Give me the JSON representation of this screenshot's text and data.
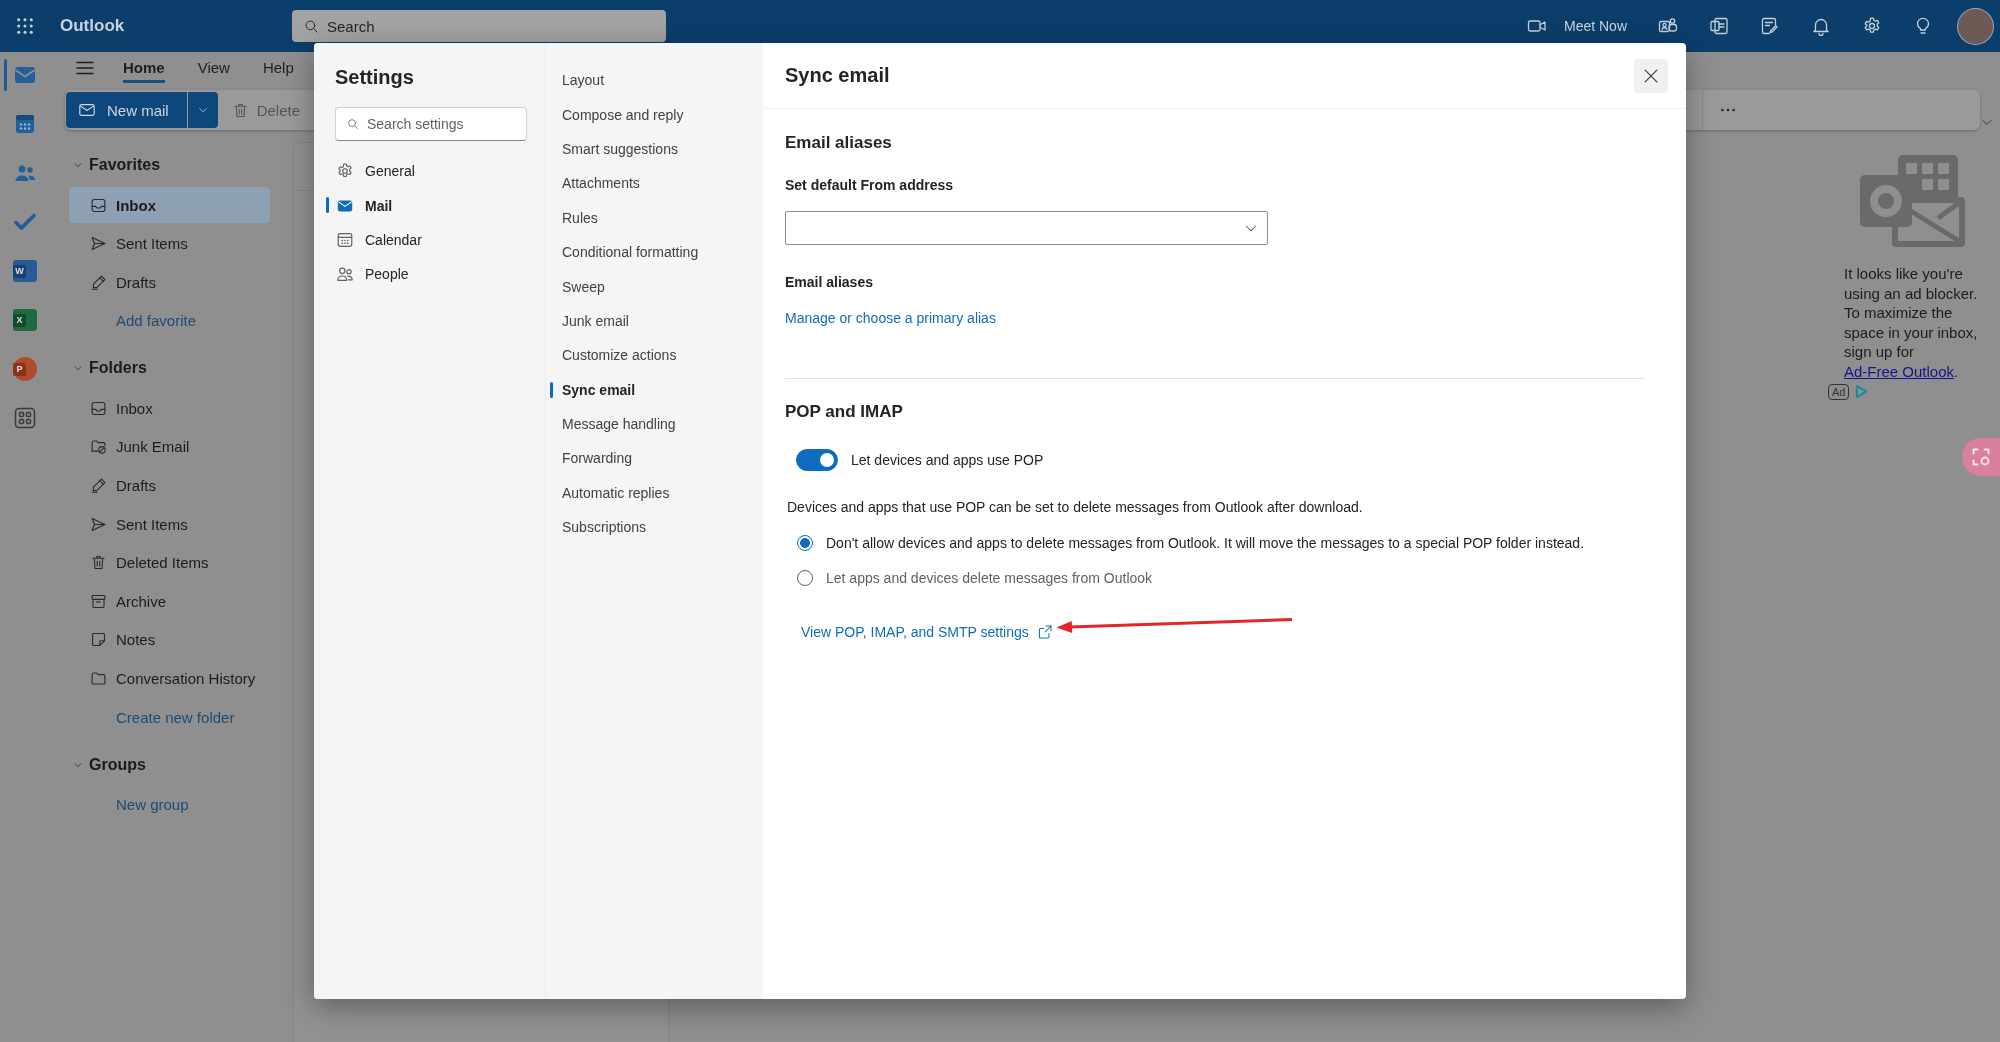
{
  "top_bar": {
    "app_name": "Outlook",
    "search": {
      "placeholder": "Search"
    },
    "meet_now": "Meet Now"
  },
  "rail": [
    {
      "kind": "mail",
      "selected": true
    },
    {
      "kind": "calendar",
      "selected": false
    },
    {
      "kind": "people",
      "selected": false
    },
    {
      "kind": "todo",
      "selected": false
    },
    {
      "kind": "word",
      "letter": "W",
      "selected": false
    },
    {
      "kind": "excel",
      "letter": "X",
      "selected": false
    },
    {
      "kind": "powerpoint",
      "letter": "P",
      "selected": false
    },
    {
      "kind": "apps",
      "selected": false
    }
  ],
  "ribbon": {
    "tabs": [
      {
        "label": "Home",
        "selected": true
      },
      {
        "label": "View",
        "selected": false
      },
      {
        "label": "Help",
        "selected": false
      }
    ],
    "new_mail": "New mail",
    "delete": {
      "label": "Delete",
      "disabled": true
    }
  },
  "folder_pane": {
    "sections": [
      {
        "title": "Favorites",
        "expanded": true,
        "items": [
          {
            "label": "Inbox",
            "kind": "inbox",
            "selected": true
          },
          {
            "label": "Sent Items",
            "kind": "sent",
            "selected": false
          },
          {
            "label": "Drafts",
            "kind": "drafts",
            "selected": false
          }
        ],
        "action": "Add favorite"
      },
      {
        "title": "Folders",
        "expanded": true,
        "items": [
          {
            "label": "Inbox",
            "kind": "inbox",
            "selected": false
          },
          {
            "label": "Junk Email",
            "kind": "junk",
            "selected": false
          },
          {
            "label": "Drafts",
            "kind": "drafts",
            "selected": false
          },
          {
            "label": "Sent Items",
            "kind": "sent",
            "selected": false
          },
          {
            "label": "Deleted Items",
            "kind": "deleted",
            "selected": false
          },
          {
            "label": "Archive",
            "kind": "archive",
            "selected": false
          },
          {
            "label": "Notes",
            "kind": "notes",
            "selected": false
          },
          {
            "label": "Conversation History",
            "kind": "folder",
            "selected": false
          }
        ],
        "action": "Create new folder"
      },
      {
        "title": "Groups",
        "expanded": true,
        "action": "New group"
      }
    ]
  },
  "ad": {
    "message": "It looks like you're using an ad blocker. To maximize the space in your inbox, sign up for ",
    "link": "Ad-Free Outlook",
    "message_end": ".",
    "badge": "Ad"
  },
  "settings": {
    "title": "Settings",
    "search": {
      "placeholder": "Search settings"
    },
    "categories": [
      {
        "label": "General",
        "kind": "general",
        "selected": false
      },
      {
        "label": "Mail",
        "kind": "mail",
        "selected": true
      },
      {
        "label": "Calendar",
        "kind": "calendar",
        "selected": false
      },
      {
        "label": "People",
        "kind": "people",
        "selected": false
      }
    ],
    "options": [
      {
        "label": "Layout",
        "selected": false
      },
      {
        "label": "Compose and reply",
        "selected": false
      },
      {
        "label": "Smart suggestions",
        "selected": false
      },
      {
        "label": "Attachments",
        "selected": false
      },
      {
        "label": "Rules",
        "selected": false
      },
      {
        "label": "Conditional formatting",
        "selected": false
      },
      {
        "label": "Sweep",
        "selected": false
      },
      {
        "label": "Junk email",
        "selected": false
      },
      {
        "label": "Customize actions",
        "selected": false
      },
      {
        "label": "Sync email",
        "selected": true
      },
      {
        "label": "Message handling",
        "selected": false
      },
      {
        "label": "Forwarding",
        "selected": false
      },
      {
        "label": "Automatic replies",
        "selected": false
      },
      {
        "label": "Subscriptions",
        "selected": false
      }
    ]
  },
  "sync_email": {
    "title": "Sync email",
    "aliases": {
      "heading": "Email aliases",
      "default_from_label": "Set default From address",
      "aliases_label": "Email aliases",
      "manage_link": "Manage or choose a primary alias"
    },
    "pop_imap": {
      "heading": "POP and IMAP",
      "toggle": {
        "label": "Let devices and apps use POP",
        "on": true
      },
      "description": "Devices and apps that use POP can be set to delete messages from Outlook after download.",
      "options": [
        {
          "label": "Don't allow devices and apps to delete messages from Outlook. It will move the messages to a special POP folder instead.",
          "selected": true
        },
        {
          "label": "Let apps and devices delete messages from Outlook",
          "selected": false
        }
      ],
      "settings_link": "View POP, IMAP, and SMTP settings"
    }
  }
}
